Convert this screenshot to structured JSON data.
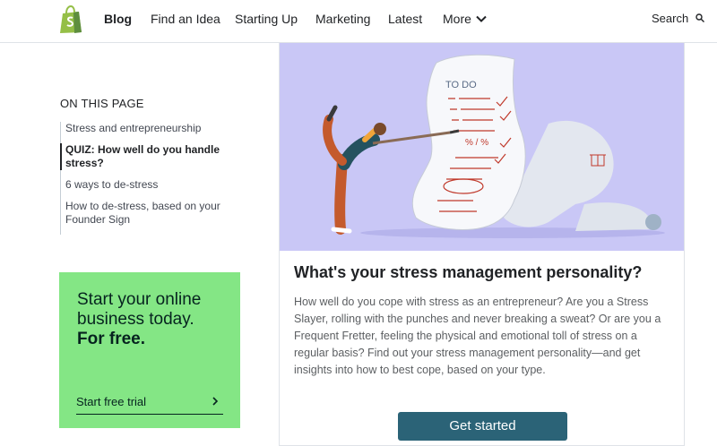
{
  "nav": {
    "logo_icon": "shopify-bag-icon",
    "items": [
      "Blog",
      "Find an Idea",
      "Starting Up",
      "Marketing",
      "Latest",
      "More"
    ],
    "search_label": "Search",
    "search_icon": "search-icon",
    "more_icon": "chevron-down-icon"
  },
  "toc": {
    "title": "ON THIS PAGE",
    "items": [
      "Stress and entrepreneurship",
      "QUIZ: How well do you handle stress?",
      "6 ways to de-stress",
      "How to de-stress, based on your Founder Sign"
    ],
    "active_index": 1
  },
  "promo": {
    "line1": "Start your online business today.",
    "line2": "For free.",
    "cta": "Start free trial",
    "cta_icon": "chevron-right-icon",
    "background": "#84e685"
  },
  "card": {
    "hero_list_heading": "TO DO",
    "hero_marks": "% / %",
    "title": "What's your stress management personality?",
    "body": "How well do you cope with stress as an entrepreneur? Are you a Stress Slayer, rolling with the punches and never breaking a sweat? Or are you a Frequent Fretter, feeling the physical and emotional toll of stress on a regular basis? Find out your stress management personality—and get insights into how to best cope, based on your type.",
    "button": "Get started",
    "button_color": "#2b6377",
    "hero_bg": "#c9c7f6"
  }
}
